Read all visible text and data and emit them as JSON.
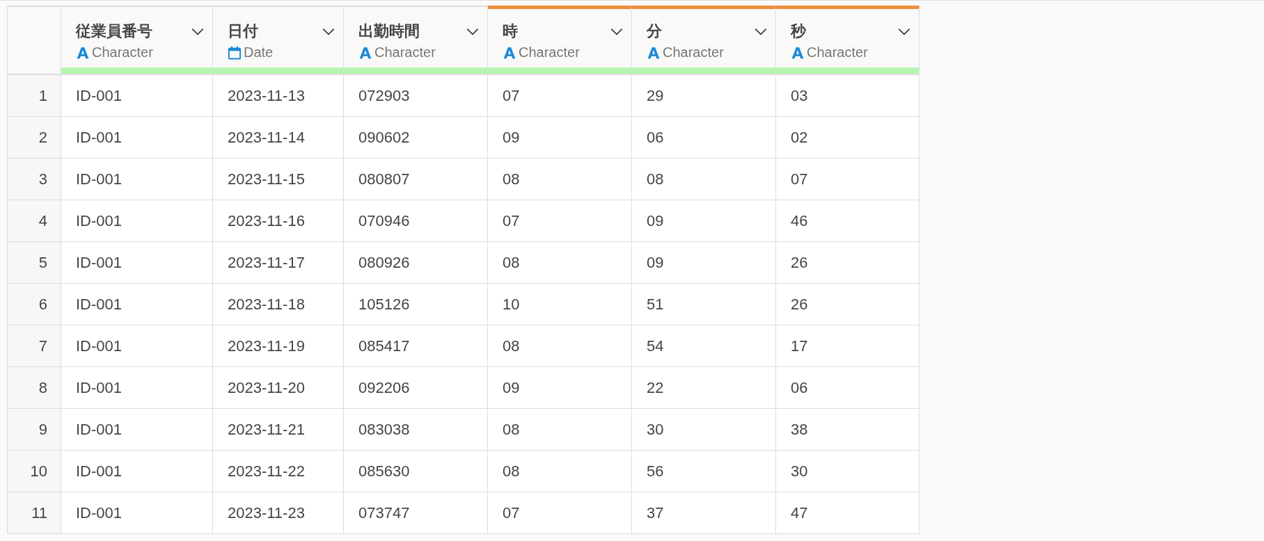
{
  "table": {
    "columns": [
      {
        "name": "従業員番号",
        "type": "Character",
        "kind": "character",
        "modified": false,
        "level": 1
      },
      {
        "name": "日付",
        "type": "Date",
        "kind": "date",
        "modified": false,
        "level": 1
      },
      {
        "name": "出勤時間",
        "type": "Character",
        "kind": "character",
        "modified": false,
        "level": 1
      },
      {
        "name": "時",
        "type": "Character",
        "kind": "character",
        "modified": true,
        "level": 1
      },
      {
        "name": "分",
        "type": "Character",
        "kind": "character",
        "modified": true,
        "level": 1
      },
      {
        "name": "秒",
        "type": "Character",
        "kind": "character",
        "modified": true,
        "level": 1
      }
    ],
    "rows": [
      {
        "number": "1",
        "cells": [
          "ID-001",
          "2023-11-13",
          "072903",
          "07",
          "29",
          "03"
        ]
      },
      {
        "number": "2",
        "cells": [
          "ID-001",
          "2023-11-14",
          "090602",
          "09",
          "06",
          "02"
        ]
      },
      {
        "number": "3",
        "cells": [
          "ID-001",
          "2023-11-15",
          "080807",
          "08",
          "08",
          "07"
        ]
      },
      {
        "number": "4",
        "cells": [
          "ID-001",
          "2023-11-16",
          "070946",
          "07",
          "09",
          "46"
        ]
      },
      {
        "number": "5",
        "cells": [
          "ID-001",
          "2023-11-17",
          "080926",
          "08",
          "09",
          "26"
        ]
      },
      {
        "number": "6",
        "cells": [
          "ID-001",
          "2023-11-18",
          "105126",
          "10",
          "51",
          "26"
        ]
      },
      {
        "number": "7",
        "cells": [
          "ID-001",
          "2023-11-19",
          "085417",
          "08",
          "54",
          "17"
        ]
      },
      {
        "number": "8",
        "cells": [
          "ID-001",
          "2023-11-20",
          "092206",
          "09",
          "22",
          "06"
        ]
      },
      {
        "number": "9",
        "cells": [
          "ID-001",
          "2023-11-21",
          "083038",
          "08",
          "30",
          "38"
        ]
      },
      {
        "number": "10",
        "cells": [
          "ID-001",
          "2023-11-22",
          "085630",
          "08",
          "56",
          "30"
        ]
      },
      {
        "number": "11",
        "cells": [
          "ID-001",
          "2023-11-23",
          "073747",
          "07",
          "37",
          "47"
        ]
      }
    ]
  }
}
